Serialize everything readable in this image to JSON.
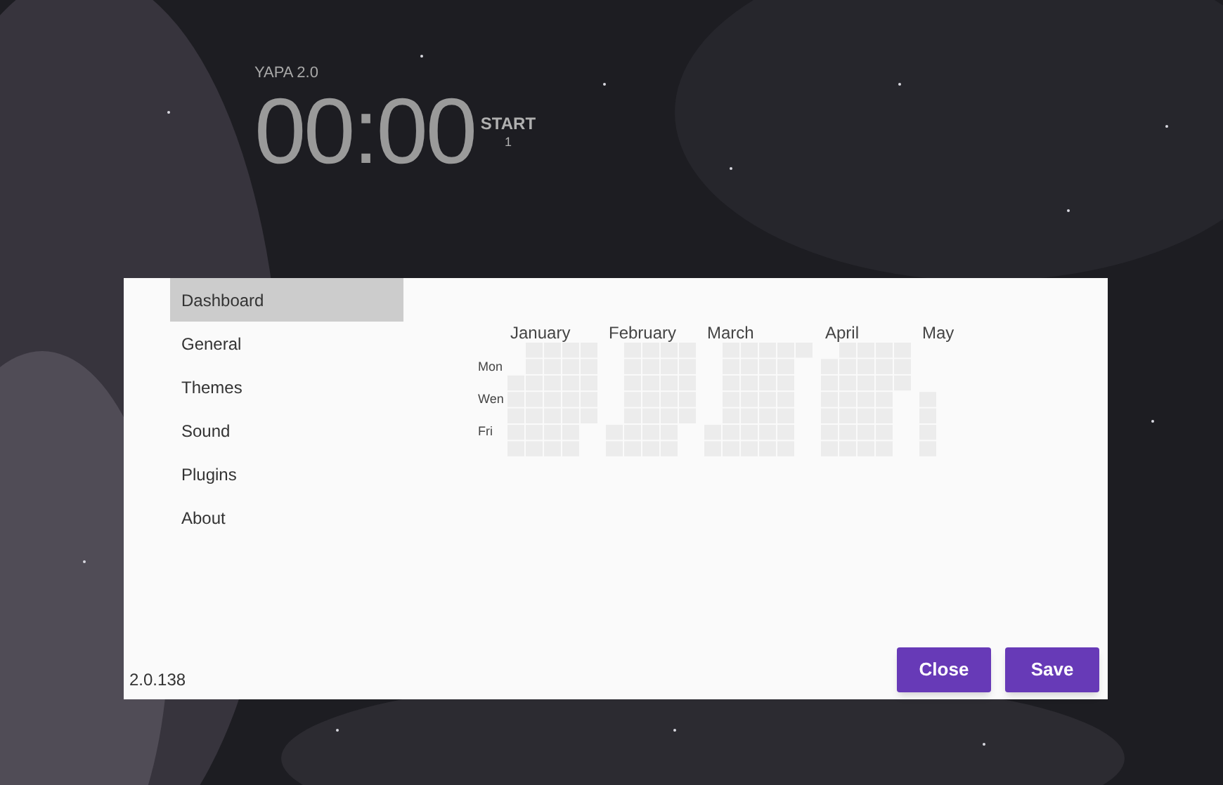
{
  "app": {
    "title": "YAPA 2.0",
    "timer": "00:00",
    "action": "START",
    "count": "1"
  },
  "sidebar": {
    "items": [
      {
        "label": "Dashboard",
        "selected": true
      },
      {
        "label": "General",
        "selected": false
      },
      {
        "label": "Themes",
        "selected": false
      },
      {
        "label": "Sound",
        "selected": false
      },
      {
        "label": "Plugins",
        "selected": false
      },
      {
        "label": "About",
        "selected": false
      }
    ]
  },
  "heatmap": {
    "months": [
      "January",
      "February",
      "March",
      "April",
      "May"
    ],
    "weekdays": [
      "Mon",
      "Wen",
      "Fri"
    ]
  },
  "version": "2.0.138",
  "buttons": [
    "Close",
    "Save"
  ]
}
